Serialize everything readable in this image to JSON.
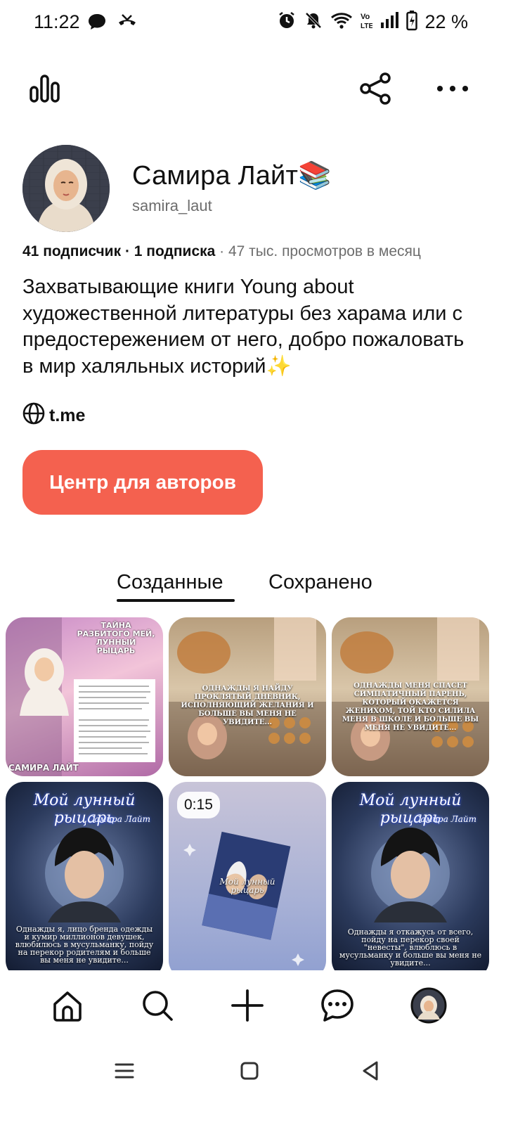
{
  "status_bar": {
    "time": "11:22",
    "battery": "22 %",
    "left_icons": [
      "chat-bubble-icon",
      "missed-call-icon"
    ],
    "right_icons": [
      "alarm-icon",
      "bell-muted-icon",
      "wifi-icon",
      "volte-icon",
      "signal-icon",
      "battery-charging-icon"
    ]
  },
  "topbar": {
    "icons": [
      "analytics-icon",
      "share-icon",
      "more-icon"
    ]
  },
  "profile": {
    "name": "Самира Лайт📚",
    "username": "samira_laut",
    "stats": {
      "followers": "41 подписчик",
      "separator": " · ",
      "following": "1 подписка",
      "views": " · 47 тыс. просмотров в месяц"
    },
    "bio": "Захватывающие книги Young about художественной литературы без харама или с предостережением от него, добро пожаловать в мир халяльных историй✨",
    "link": "t.me",
    "cta_label": "Центр для авторов"
  },
  "tabs": [
    {
      "label": "Созданные",
      "active": true
    },
    {
      "label": "Сохранено",
      "active": false
    }
  ],
  "pins": [
    {
      "id": "pin-1",
      "title": "ТАЙНА РАЗБИТОГО МЕЙ, ЛУННЫЙ РЫЦАРЬ",
      "author": "САМИРА ЛАЙТ"
    },
    {
      "id": "pin-2",
      "text": "ОДНАЖДЫ Я НАЙДУ ПРОКЛЯТЫЙ ДНЕВНИК, ИСПОЛНЯЮЩИЙ ЖЕЛАНИЯ И БОЛЬШЕ ВЫ МЕНЯ НЕ УВИДИТЕ..."
    },
    {
      "id": "pin-3",
      "text": "ОДНАЖДЫ МЕНЯ СПАСЕТ СИМПАТИЧНЫЙ ПАРЕНЬ, КОТОРЫЙ ОКАЖЕТСЯ ЖЕНИХОМ, ТОЙ КТО СИЛИЛА МЕНЯ В ШКОЛЕ И БОЛЬШЕ ВЫ МЕНЯ НЕ УВИДИТЕ..."
    },
    {
      "id": "pin-4",
      "title": "Мой лунный рыцарь",
      "author": "Самира Лайт",
      "text": "Однажды я, лицо бренда одежды и кумир миллионов девушек, влюбилюсь в мусульманку, пойду на перекор родителям и больше вы меня не увидите..."
    },
    {
      "id": "pin-5",
      "duration": "0:15",
      "book_title": "Мой лунный рыцарь"
    },
    {
      "id": "pin-6",
      "title": "Мой лунный рыцарь",
      "author": "Самира Лайт",
      "text": "Однажды я откажусь от всего, пойду на перекор своей \"невесты\", влюблюсь в мусульманку и больше вы меня не увидите..."
    }
  ],
  "bottom_nav": [
    "home-icon",
    "search-icon",
    "create-icon",
    "messages-icon",
    "profile-avatar-icon"
  ],
  "system_nav": [
    "recents-icon",
    "home-square-icon",
    "back-icon"
  ],
  "colors": {
    "accent": "#f4614f",
    "text": "#111111",
    "muted": "#6d6d6d"
  }
}
